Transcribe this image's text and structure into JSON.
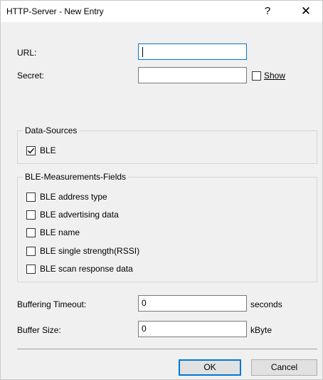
{
  "window": {
    "title": "HTTP-Server - New Entry",
    "help_label": "?",
    "close_label": "✕"
  },
  "form": {
    "url_label": "URL:",
    "url_value": "",
    "secret_label": "Secret:",
    "secret_value": "",
    "show_label": "Show",
    "show_checked": false
  },
  "data_sources": {
    "title": "Data-Sources",
    "items": [
      {
        "label": "BLE",
        "checked": true
      }
    ]
  },
  "measurement_fields": {
    "title": "BLE-Measurements-Fields",
    "items": [
      {
        "label": "BLE address type",
        "checked": false
      },
      {
        "label": "BLE advertising data",
        "checked": false
      },
      {
        "label": "BLE name",
        "checked": false
      },
      {
        "label": "BLE single strength(RSSI)",
        "checked": false
      },
      {
        "label": "BLE scan response data",
        "checked": false
      }
    ]
  },
  "buffering": {
    "timeout_label": "Buffering Timeout:",
    "timeout_value": "0",
    "timeout_unit": "seconds",
    "size_label": "Buffer Size:",
    "size_value": "0",
    "size_unit": "kByte"
  },
  "buttons": {
    "ok_label": "OK",
    "cancel_label": "Cancel"
  },
  "colors": {
    "focus_border": "#0078d7",
    "dialog_bg": "#f0f0f0"
  }
}
